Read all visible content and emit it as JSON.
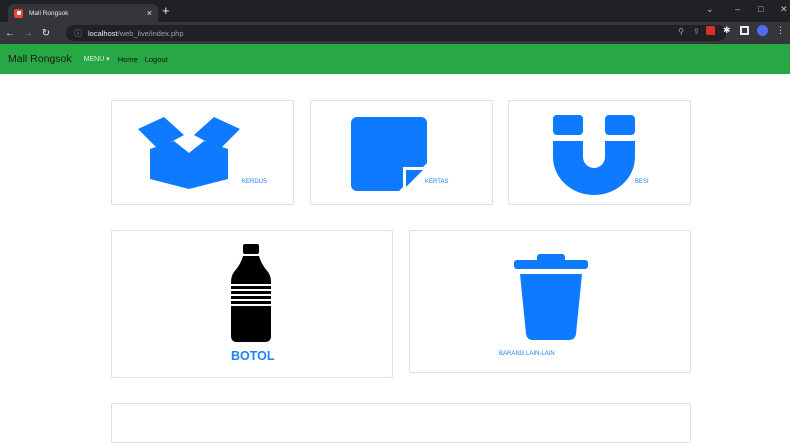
{
  "browser": {
    "tab_title": "Mall Rongsok",
    "tab_close": "×",
    "new_tab": "+",
    "url_info": "ⓘ",
    "url_host": "localhost",
    "url_path": "/web_live/index.php",
    "window_controls": [
      "⌄",
      "–",
      "□",
      "✕"
    ]
  },
  "navbar": {
    "brand": "Mall Rongsok",
    "menu_label": "MENU ▾",
    "links": [
      "Home",
      "Logout"
    ]
  },
  "categories": [
    {
      "label": "KERDUS",
      "icon": "box-icon"
    },
    {
      "label": "KERTAS",
      "icon": "paper-icon"
    },
    {
      "label": "BESI",
      "icon": "magnet-icon"
    },
    {
      "label": "BOTOL",
      "icon": "bottle-icon"
    },
    {
      "label": "BARANG LAIN-LAIN",
      "icon": "trash-icon"
    }
  ],
  "colors": {
    "accent": "#0d7aff",
    "navbar": "#28a745",
    "browser_dark": "#202124"
  }
}
